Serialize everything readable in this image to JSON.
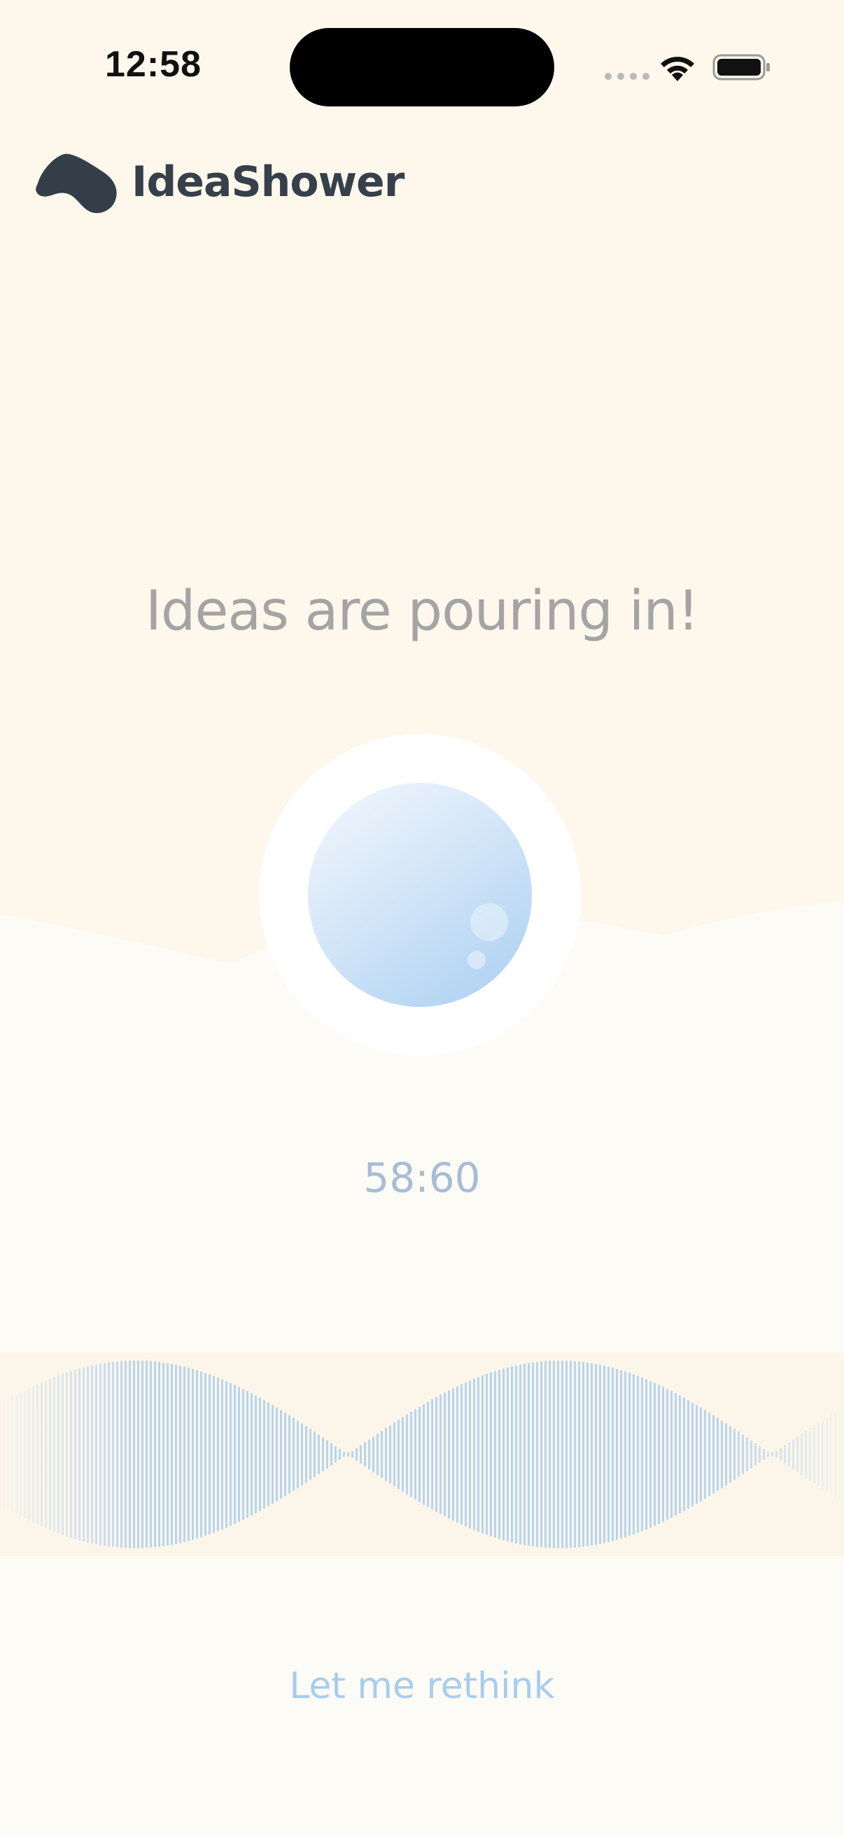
{
  "status_bar": {
    "time": "12:58",
    "icons": [
      "signal-dots-icon",
      "wifi-icon",
      "battery-icon"
    ]
  },
  "header": {
    "logo_icon": "idea-shower-logo-icon",
    "app_name": "IdeaShower"
  },
  "main": {
    "headline": "Ideas are pouring in!",
    "record_button_icon": "bubble-icon",
    "timer": "58:60"
  },
  "footer": {
    "rethink_label": "Let me rethink"
  },
  "colors": {
    "background_top": "#fdf7ec",
    "background_bottom": "#fdfbf6",
    "text_dark": "#35404a",
    "headline_gray": "#a4a4a4",
    "timer_blue": "#a7bdd4",
    "accent_blue": "#a6cdee",
    "waveform_blue": "#b7d5ef"
  }
}
